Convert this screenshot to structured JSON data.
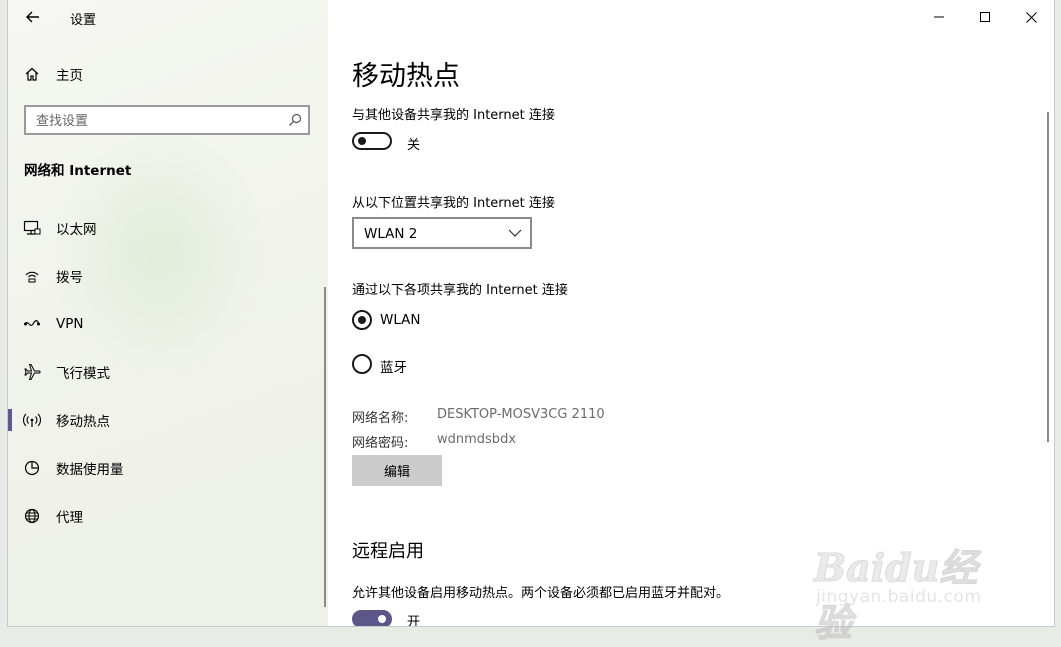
{
  "window": {
    "title": "设置"
  },
  "sidebar": {
    "home_label": "主页",
    "search_placeholder": "查找设置",
    "section_title": "网络和 Internet",
    "items": [
      {
        "label": "以太网",
        "icon": "ethernet-icon"
      },
      {
        "label": "拨号",
        "icon": "dialup-icon"
      },
      {
        "label": "VPN",
        "icon": "vpn-icon"
      },
      {
        "label": "飞行模式",
        "icon": "airplane-icon"
      },
      {
        "label": "移动热点",
        "icon": "hotspot-icon",
        "active": true
      },
      {
        "label": "数据使用量",
        "icon": "data-usage-icon"
      },
      {
        "label": "代理",
        "icon": "globe-icon"
      }
    ]
  },
  "main": {
    "page_title": "移动热点",
    "share_label": "与其他设备共享我的 Internet 连接",
    "share_toggle": {
      "state": "off",
      "label": "关"
    },
    "from_label": "从以下位置共享我的 Internet 连接",
    "from_value": "WLAN 2",
    "over_label": "通过以下各项共享我的 Internet 连接",
    "over_options": [
      {
        "label": "WLAN",
        "checked": true
      },
      {
        "label": "蓝牙",
        "checked": false
      }
    ],
    "network_name_key": "网络名称:",
    "network_name_value": "DESKTOP-MOSV3CG 2110",
    "network_password_key": "网络密码:",
    "network_password_value": "wdnmdsbdx",
    "edit_button": "编辑",
    "remote_title": "远程启用",
    "remote_desc": "允许其他设备启用移动热点。两个设备必须都已启用蓝牙并配对。",
    "remote_toggle": {
      "state": "on",
      "label": "开"
    }
  },
  "watermark": {
    "brand": "Baidu经验",
    "sub": "jingyan.baidu.com"
  },
  "colors": {
    "accent": "#5c5689",
    "active_marker": "#605a8a",
    "button_gray": "#cccccc"
  }
}
